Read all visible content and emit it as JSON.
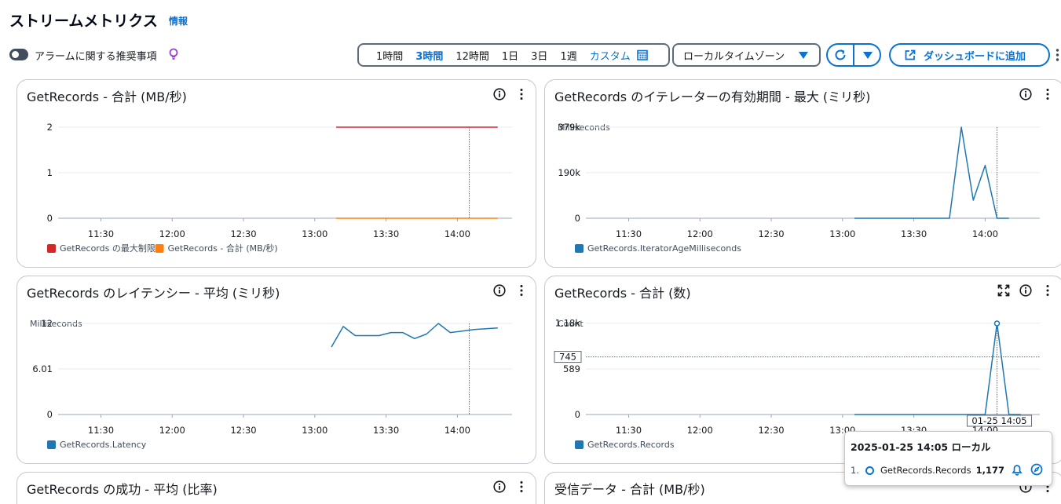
{
  "header": {
    "title": "ストリームメトリクス",
    "info": "情報",
    "alarm_toggle_label": "アラームに関する推奨事項"
  },
  "toolbar": {
    "time_ranges": [
      "1時間",
      "3時間",
      "12時間",
      "1日",
      "3日",
      "1週"
    ],
    "active_range": "3時間",
    "custom_label": "カスタム",
    "timezone": "ローカルタイムゾーン",
    "add_dashboard": "ダッシュボードに追加"
  },
  "colors": {
    "accent": "#0972d3",
    "series_blue": "#1f77b4",
    "series_red": "#d62728",
    "series_orange": "#ff7f0e"
  },
  "panels": [
    {
      "title": "GetRecords - 合計 (MB/秒)"
    },
    {
      "title": "GetRecords のイテレーターの有効期間 - 最大 (ミリ秒)"
    },
    {
      "title": "GetRecords のレイテンシー - 平均 (ミリ秒)"
    },
    {
      "title": "GetRecords - 合計 (数)"
    },
    {
      "title": "GetRecords の成功 - 平均 (比率)"
    },
    {
      "title": "受信データ - 合計 (MB/秒)"
    }
  ],
  "chart_data": [
    {
      "type": "line",
      "title": "GetRecords - 合計 (MB/秒)",
      "ylabel": "",
      "x_ticks": [
        "11:30",
        "12:00",
        "12:30",
        "13:00",
        "13:30",
        "14:00"
      ],
      "y_ticks": [
        "0",
        "1",
        "2"
      ],
      "xlim": [
        "11:12",
        "14:23"
      ],
      "ylim": [
        0,
        2
      ],
      "legend_position": "bottom-left",
      "series": [
        {
          "name": "GetRecords の最大制限",
          "color": "#d62728",
          "points": [
            [
              "13:09",
              2
            ],
            [
              "14:17",
              2
            ]
          ]
        },
        {
          "name": "GetRecords - 合計 (MB/秒)",
          "color": "#ff7f0e",
          "points": [
            [
              "13:09",
              0
            ],
            [
              "14:17",
              0
            ]
          ]
        }
      ],
      "crosshair_x": "14:05"
    },
    {
      "type": "line",
      "title": "GetRecords のイテレーターの有効期間 - 最大 (ミリ秒)",
      "ylabel": "Milliseconds",
      "x_ticks": [
        "11:30",
        "12:00",
        "12:30",
        "13:00",
        "13:30",
        "14:00"
      ],
      "y_ticks": [
        "0",
        "190k",
        "379k"
      ],
      "xlim": [
        "11:12",
        "14:23"
      ],
      "ylim": [
        0,
        379000
      ],
      "legend_position": "bottom-left",
      "series": [
        {
          "name": "GetRecords.IteratorAgeMilliseconds",
          "color": "#1f77b4",
          "points": [
            [
              "13:05",
              0
            ],
            [
              "13:45",
              0
            ],
            [
              "13:50",
              379000
            ],
            [
              "13:55",
              75000
            ],
            [
              "14:00",
              220000
            ],
            [
              "14:05",
              0
            ],
            [
              "14:10",
              0
            ]
          ]
        }
      ],
      "crosshair_x": "14:05"
    },
    {
      "type": "line",
      "title": "GetRecords のレイテンシー - 平均 (ミリ秒)",
      "ylabel": "Milliseconds",
      "x_ticks": [
        "11:30",
        "12:00",
        "12:30",
        "13:00",
        "13:30",
        "14:00"
      ],
      "y_ticks": [
        "0",
        "6.01",
        "12"
      ],
      "xlim": [
        "11:12",
        "14:23"
      ],
      "ylim": [
        0,
        12
      ],
      "legend_position": "bottom-left",
      "series": [
        {
          "name": "GetRecords.Latency",
          "color": "#1f77b4",
          "points": [
            [
              "13:07",
              8.9
            ],
            [
              "13:12",
              11.6
            ],
            [
              "13:17",
              10.4
            ],
            [
              "13:22",
              10.4
            ],
            [
              "13:27",
              10.4
            ],
            [
              "13:32",
              10.8
            ],
            [
              "13:37",
              10.8
            ],
            [
              "13:42",
              10.0
            ],
            [
              "13:47",
              10.6
            ],
            [
              "13:52",
              12.0
            ],
            [
              "13:57",
              10.8
            ],
            [
              "14:02",
              11.0
            ],
            [
              "14:07",
              11.2
            ],
            [
              "14:12",
              11.3
            ],
            [
              "14:17",
              11.4
            ]
          ]
        }
      ],
      "crosshair_x": "14:05"
    },
    {
      "type": "line",
      "title": "GetRecords - 合計 (数)",
      "ylabel": "Count",
      "x_ticks": [
        "11:30",
        "12:00",
        "12:30",
        "13:00",
        "13:30",
        "14:00"
      ],
      "y_ticks": [
        "0",
        "589",
        "1.18k"
      ],
      "xlim": [
        "11:12",
        "14:23"
      ],
      "ylim": [
        0,
        1177
      ],
      "legend_position": "bottom-left",
      "series": [
        {
          "name": "GetRecords.Records",
          "color": "#1f77b4",
          "points": [
            [
              "13:05",
              0
            ],
            [
              "13:55",
              0
            ],
            [
              "14:00",
              0
            ],
            [
              "14:05",
              1177
            ],
            [
              "14:10",
              0
            ],
            [
              "14:15",
              0
            ]
          ]
        }
      ],
      "crosshair_x": "14:05",
      "hover_y_label": "745",
      "hover_x_label": "01-25 14:05",
      "tooltip": {
        "title": "2025-01-25 14:05 ローカル",
        "index": "1.",
        "series": "GetRecords.Records",
        "value": "1,177"
      }
    }
  ]
}
